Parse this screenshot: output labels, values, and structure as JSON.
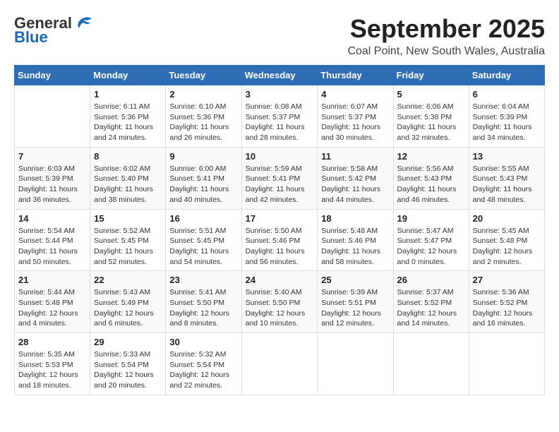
{
  "header": {
    "logo_general": "General",
    "logo_blue": "Blue",
    "month": "September 2025",
    "location": "Coal Point, New South Wales, Australia"
  },
  "weekdays": [
    "Sunday",
    "Monday",
    "Tuesday",
    "Wednesday",
    "Thursday",
    "Friday",
    "Saturday"
  ],
  "weeks": [
    [
      {
        "day": "",
        "info": ""
      },
      {
        "day": "1",
        "info": "Sunrise: 6:11 AM\nSunset: 5:36 PM\nDaylight: 11 hours\nand 24 minutes."
      },
      {
        "day": "2",
        "info": "Sunrise: 6:10 AM\nSunset: 5:36 PM\nDaylight: 11 hours\nand 26 minutes."
      },
      {
        "day": "3",
        "info": "Sunrise: 6:08 AM\nSunset: 5:37 PM\nDaylight: 11 hours\nand 28 minutes."
      },
      {
        "day": "4",
        "info": "Sunrise: 6:07 AM\nSunset: 5:37 PM\nDaylight: 11 hours\nand 30 minutes."
      },
      {
        "day": "5",
        "info": "Sunrise: 6:06 AM\nSunset: 5:38 PM\nDaylight: 11 hours\nand 32 minutes."
      },
      {
        "day": "6",
        "info": "Sunrise: 6:04 AM\nSunset: 5:39 PM\nDaylight: 11 hours\nand 34 minutes."
      }
    ],
    [
      {
        "day": "7",
        "info": "Sunrise: 6:03 AM\nSunset: 5:39 PM\nDaylight: 11 hours\nand 36 minutes."
      },
      {
        "day": "8",
        "info": "Sunrise: 6:02 AM\nSunset: 5:40 PM\nDaylight: 11 hours\nand 38 minutes."
      },
      {
        "day": "9",
        "info": "Sunrise: 6:00 AM\nSunset: 5:41 PM\nDaylight: 11 hours\nand 40 minutes."
      },
      {
        "day": "10",
        "info": "Sunrise: 5:59 AM\nSunset: 5:41 PM\nDaylight: 11 hours\nand 42 minutes."
      },
      {
        "day": "11",
        "info": "Sunrise: 5:58 AM\nSunset: 5:42 PM\nDaylight: 11 hours\nand 44 minutes."
      },
      {
        "day": "12",
        "info": "Sunrise: 5:56 AM\nSunset: 5:43 PM\nDaylight: 11 hours\nand 46 minutes."
      },
      {
        "day": "13",
        "info": "Sunrise: 5:55 AM\nSunset: 5:43 PM\nDaylight: 11 hours\nand 48 minutes."
      }
    ],
    [
      {
        "day": "14",
        "info": "Sunrise: 5:54 AM\nSunset: 5:44 PM\nDaylight: 11 hours\nand 50 minutes."
      },
      {
        "day": "15",
        "info": "Sunrise: 5:52 AM\nSunset: 5:45 PM\nDaylight: 11 hours\nand 52 minutes."
      },
      {
        "day": "16",
        "info": "Sunrise: 5:51 AM\nSunset: 5:45 PM\nDaylight: 11 hours\nand 54 minutes."
      },
      {
        "day": "17",
        "info": "Sunrise: 5:50 AM\nSunset: 5:46 PM\nDaylight: 11 hours\nand 56 minutes."
      },
      {
        "day": "18",
        "info": "Sunrise: 5:48 AM\nSunset: 5:46 PM\nDaylight: 11 hours\nand 58 minutes."
      },
      {
        "day": "19",
        "info": "Sunrise: 5:47 AM\nSunset: 5:47 PM\nDaylight: 12 hours\nand 0 minutes."
      },
      {
        "day": "20",
        "info": "Sunrise: 5:45 AM\nSunset: 5:48 PM\nDaylight: 12 hours\nand 2 minutes."
      }
    ],
    [
      {
        "day": "21",
        "info": "Sunrise: 5:44 AM\nSunset: 5:48 PM\nDaylight: 12 hours\nand 4 minutes."
      },
      {
        "day": "22",
        "info": "Sunrise: 5:43 AM\nSunset: 5:49 PM\nDaylight: 12 hours\nand 6 minutes."
      },
      {
        "day": "23",
        "info": "Sunrise: 5:41 AM\nSunset: 5:50 PM\nDaylight: 12 hours\nand 8 minutes."
      },
      {
        "day": "24",
        "info": "Sunrise: 5:40 AM\nSunset: 5:50 PM\nDaylight: 12 hours\nand 10 minutes."
      },
      {
        "day": "25",
        "info": "Sunrise: 5:39 AM\nSunset: 5:51 PM\nDaylight: 12 hours\nand 12 minutes."
      },
      {
        "day": "26",
        "info": "Sunrise: 5:37 AM\nSunset: 5:52 PM\nDaylight: 12 hours\nand 14 minutes."
      },
      {
        "day": "27",
        "info": "Sunrise: 5:36 AM\nSunset: 5:52 PM\nDaylight: 12 hours\nand 16 minutes."
      }
    ],
    [
      {
        "day": "28",
        "info": "Sunrise: 5:35 AM\nSunset: 5:53 PM\nDaylight: 12 hours\nand 18 minutes."
      },
      {
        "day": "29",
        "info": "Sunrise: 5:33 AM\nSunset: 5:54 PM\nDaylight: 12 hours\nand 20 minutes."
      },
      {
        "day": "30",
        "info": "Sunrise: 5:32 AM\nSunset: 5:54 PM\nDaylight: 12 hours\nand 22 minutes."
      },
      {
        "day": "",
        "info": ""
      },
      {
        "day": "",
        "info": ""
      },
      {
        "day": "",
        "info": ""
      },
      {
        "day": "",
        "info": ""
      }
    ]
  ]
}
